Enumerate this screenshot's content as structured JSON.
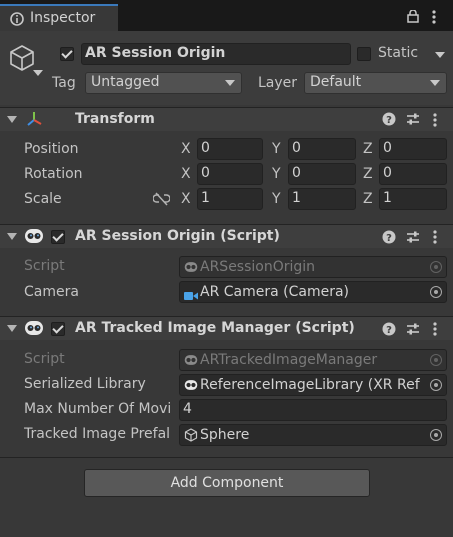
{
  "tab": {
    "title": "Inspector"
  },
  "gameobject": {
    "active": true,
    "name": "AR Session Origin",
    "static_label": "Static",
    "static_checked": false,
    "tag_label": "Tag",
    "tag_value": "Untagged",
    "layer_label": "Layer",
    "layer_value": "Default"
  },
  "transform": {
    "title": "Transform",
    "position": {
      "label": "Position",
      "x": "0",
      "y": "0",
      "z": "0"
    },
    "rotation": {
      "label": "Rotation",
      "x": "0",
      "y": "0",
      "z": "0"
    },
    "scale": {
      "label": "Scale",
      "x": "1",
      "y": "1",
      "z": "1"
    },
    "axis": {
      "x": "X",
      "y": "Y",
      "z": "Z"
    }
  },
  "session_origin": {
    "title": "AR Session Origin (Script)",
    "script_label": "Script",
    "script_value": "ARSessionOrigin",
    "camera_label": "Camera",
    "camera_value": "AR Camera (Camera)"
  },
  "image_manager": {
    "title": "AR Tracked Image Manager (Script)",
    "script_label": "Script",
    "script_value": "ARTrackedImageManager",
    "library_label": "Serialized Library",
    "library_value": "ReferenceImageLibrary (XR Ref",
    "max_label": "Max Number Of Movi",
    "max_value": "4",
    "prefab_label": "Tracked Image Prefal",
    "prefab_value": "Sphere"
  },
  "add_component": "Add Component",
  "colors": {
    "accent": "#3a79bb",
    "background": "#383838",
    "field": "#2a2a2a"
  }
}
